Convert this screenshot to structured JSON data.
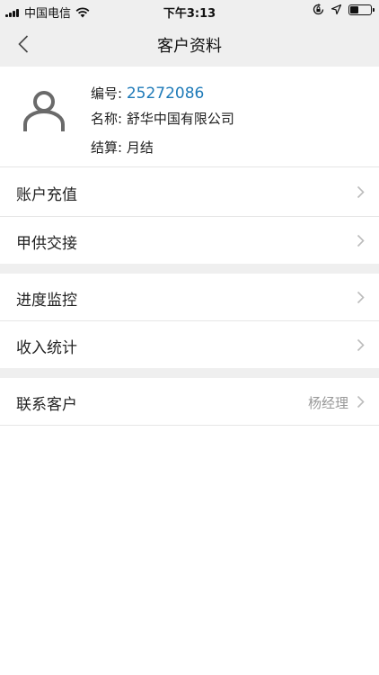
{
  "status_bar": {
    "carrier": "中国电信",
    "time": "下午3:13",
    "battery_level": 0.45
  },
  "nav": {
    "title": "客户资料"
  },
  "profile": {
    "id_label": "编号:",
    "id_value": "25272086",
    "name_label": "名称:",
    "name_value": "舒华中国有限公司",
    "settle_label": "结算:",
    "settle_value": "月结"
  },
  "menu": {
    "recharge": "账户充值",
    "supply_handover": "甲供交接",
    "progress_monitor": "进度监控",
    "income_stats": "收入统计",
    "contact": "联系客户",
    "contact_person": "杨经理"
  },
  "colors": {
    "accent_blue": "#1e7ab8",
    "background_gray": "#efefef"
  }
}
